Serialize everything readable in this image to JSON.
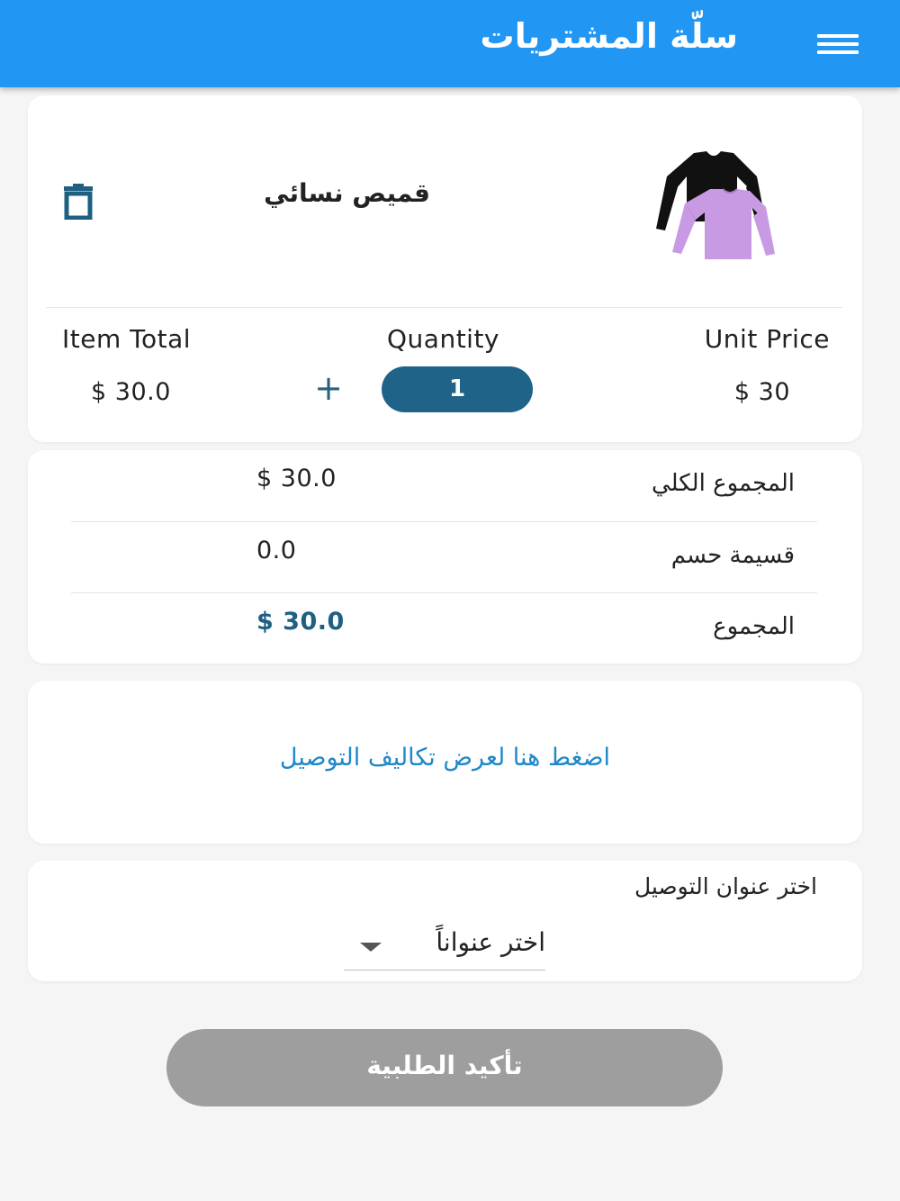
{
  "appbar": {
    "title": "سلّة المشتريات"
  },
  "product": {
    "name": "قميص نسائي",
    "unit_price_label": "Unit Price",
    "quantity_label": "Quantity",
    "item_total_label": "Item Total",
    "unit_price": "$ 30",
    "quantity": "1",
    "quantity_add_symbol": "+",
    "item_total": "$ 30.0"
  },
  "summary": {
    "subtotal_label": "المجموع الكلي",
    "subtotal_value": "$ 30.0",
    "discount_label": "قسيمة حسم",
    "discount_value": "0.0",
    "total_label": "المجموع",
    "total_value": "$ 30.0"
  },
  "delivery": {
    "link_text": "اضغط هنا لعرض تكاليف التوصيل"
  },
  "address": {
    "label": "اختر عنوان التوصيل",
    "selected": "اختر عنواناً"
  },
  "confirm": {
    "label": "تأكيد الطلبية"
  },
  "colors": {
    "appbar": "#2196f3",
    "quantity_pill": "#1f6388",
    "total_value": "#1f5f82",
    "link": "#1e88c9",
    "confirm_disabled": "#9e9e9e"
  },
  "icons": [
    "menu-icon",
    "trash-icon",
    "plus-icon",
    "caret-down-icon"
  ]
}
